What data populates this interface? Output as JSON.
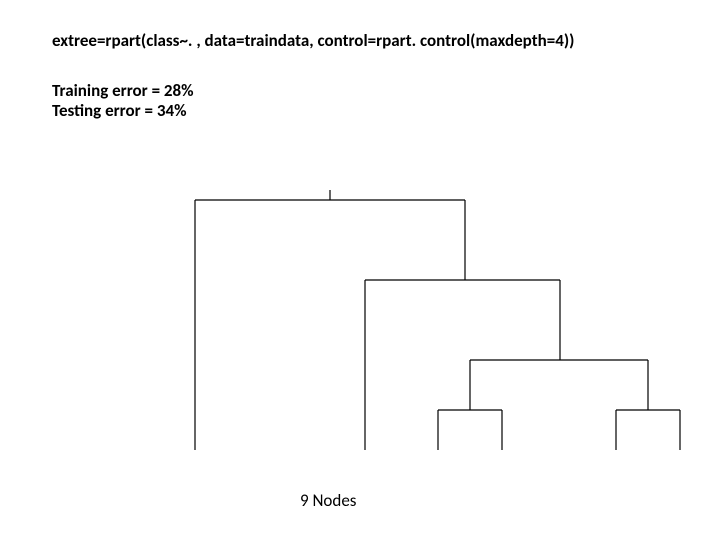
{
  "code_line": "extree=rpart(class~. , data=traindata, control=rpart. control(maxdepth=4))",
  "training_error": "Training error = 28%",
  "testing_error": "Testing error = 34%",
  "caption": "9 Nodes",
  "chart_data": {
    "type": "dendrogram",
    "note": "Binary tree dendrogram with 9 leaf nodes visible as terminal branches",
    "max_depth": 4,
    "leaf_count": 9,
    "structure": {
      "root": {
        "left": "leaf",
        "right": {
          "left": "leaf",
          "right": {
            "left": {
              "left": "leaf",
              "right": "leaf"
            },
            "right": {
              "left": "leaf",
              "right": "leaf"
            }
          }
        }
      }
    }
  }
}
